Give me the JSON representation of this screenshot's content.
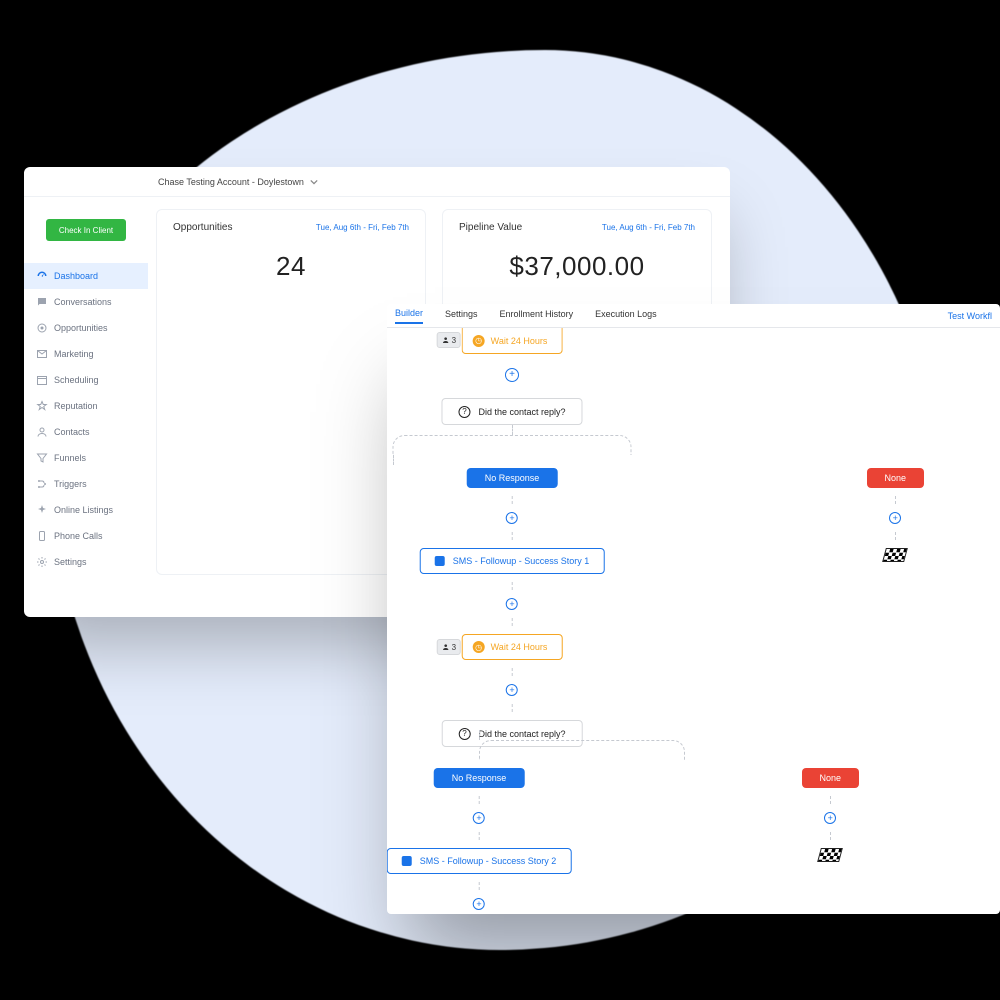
{
  "dashboard": {
    "account_name": "Chase Testing Account - Doylestown",
    "checkin_label": "Check In Client",
    "nav": [
      {
        "k": "dashboard",
        "label": "Dashboard"
      },
      {
        "k": "conversations",
        "label": "Conversations"
      },
      {
        "k": "opportunities",
        "label": "Opportunities"
      },
      {
        "k": "marketing",
        "label": "Marketing"
      },
      {
        "k": "scheduling",
        "label": "Scheduling"
      },
      {
        "k": "reputation",
        "label": "Reputation"
      },
      {
        "k": "contacts",
        "label": "Contacts"
      },
      {
        "k": "funnels",
        "label": "Funnels"
      },
      {
        "k": "triggers",
        "label": "Triggers"
      },
      {
        "k": "online-listings",
        "label": "Online Listings"
      },
      {
        "k": "phone-calls",
        "label": "Phone Calls"
      },
      {
        "k": "settings",
        "label": "Settings"
      }
    ],
    "cards": {
      "opportunities": {
        "title": "Opportunities",
        "range": "Tue, Aug 6th - Fri, Feb 7th",
        "value": "24"
      },
      "pipeline": {
        "title": "Pipeline Value",
        "range": "Tue, Aug 6th - Fri, Feb 7th",
        "value": "$37,000.00"
      }
    }
  },
  "workflow": {
    "tabs": {
      "builder": "Builder",
      "settings": "Settings",
      "history": "Enrollment History",
      "logs": "Execution Logs"
    },
    "test_workflow_label": "Test Workfl",
    "wait_label": "Wait 24 Hours",
    "enroll_count": "3",
    "condition_label": "Did the contact reply?",
    "no_response_label": "No Response",
    "none_label": "None",
    "sms1_label": "SMS - Followup - Success Story 1",
    "sms2_label": "SMS - Followup - Success Story 2"
  }
}
